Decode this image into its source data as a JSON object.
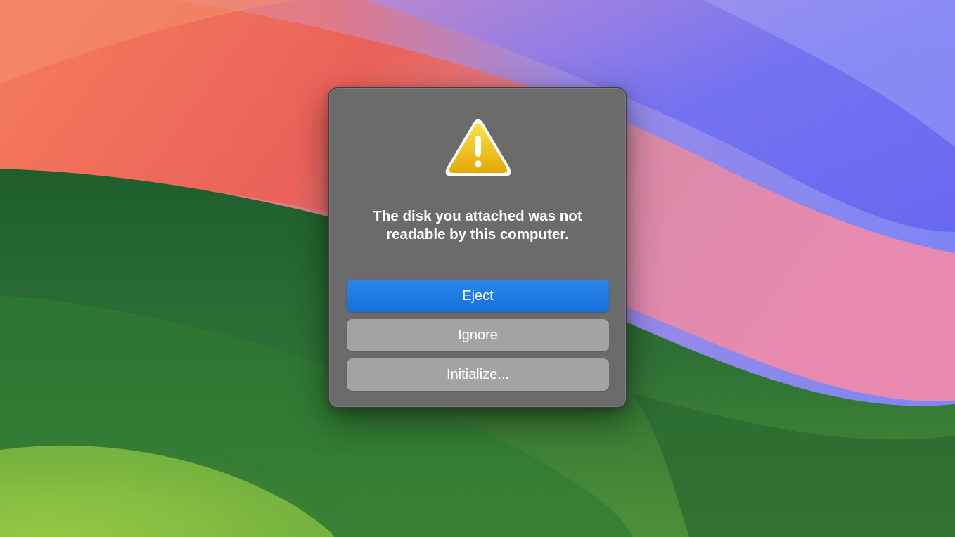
{
  "dialog": {
    "icon": "warning-triangle-icon",
    "message": "The disk you attached was not readable by this computer.",
    "buttons": {
      "eject": "Eject",
      "ignore": "Ignore",
      "initialize": "Initialize..."
    }
  },
  "colors": {
    "dialog_background": "#6b6b6b",
    "primary_button": "#1a74e0",
    "secondary_button": "#a3a3a3",
    "warning_yellow": "#f2c00e"
  }
}
